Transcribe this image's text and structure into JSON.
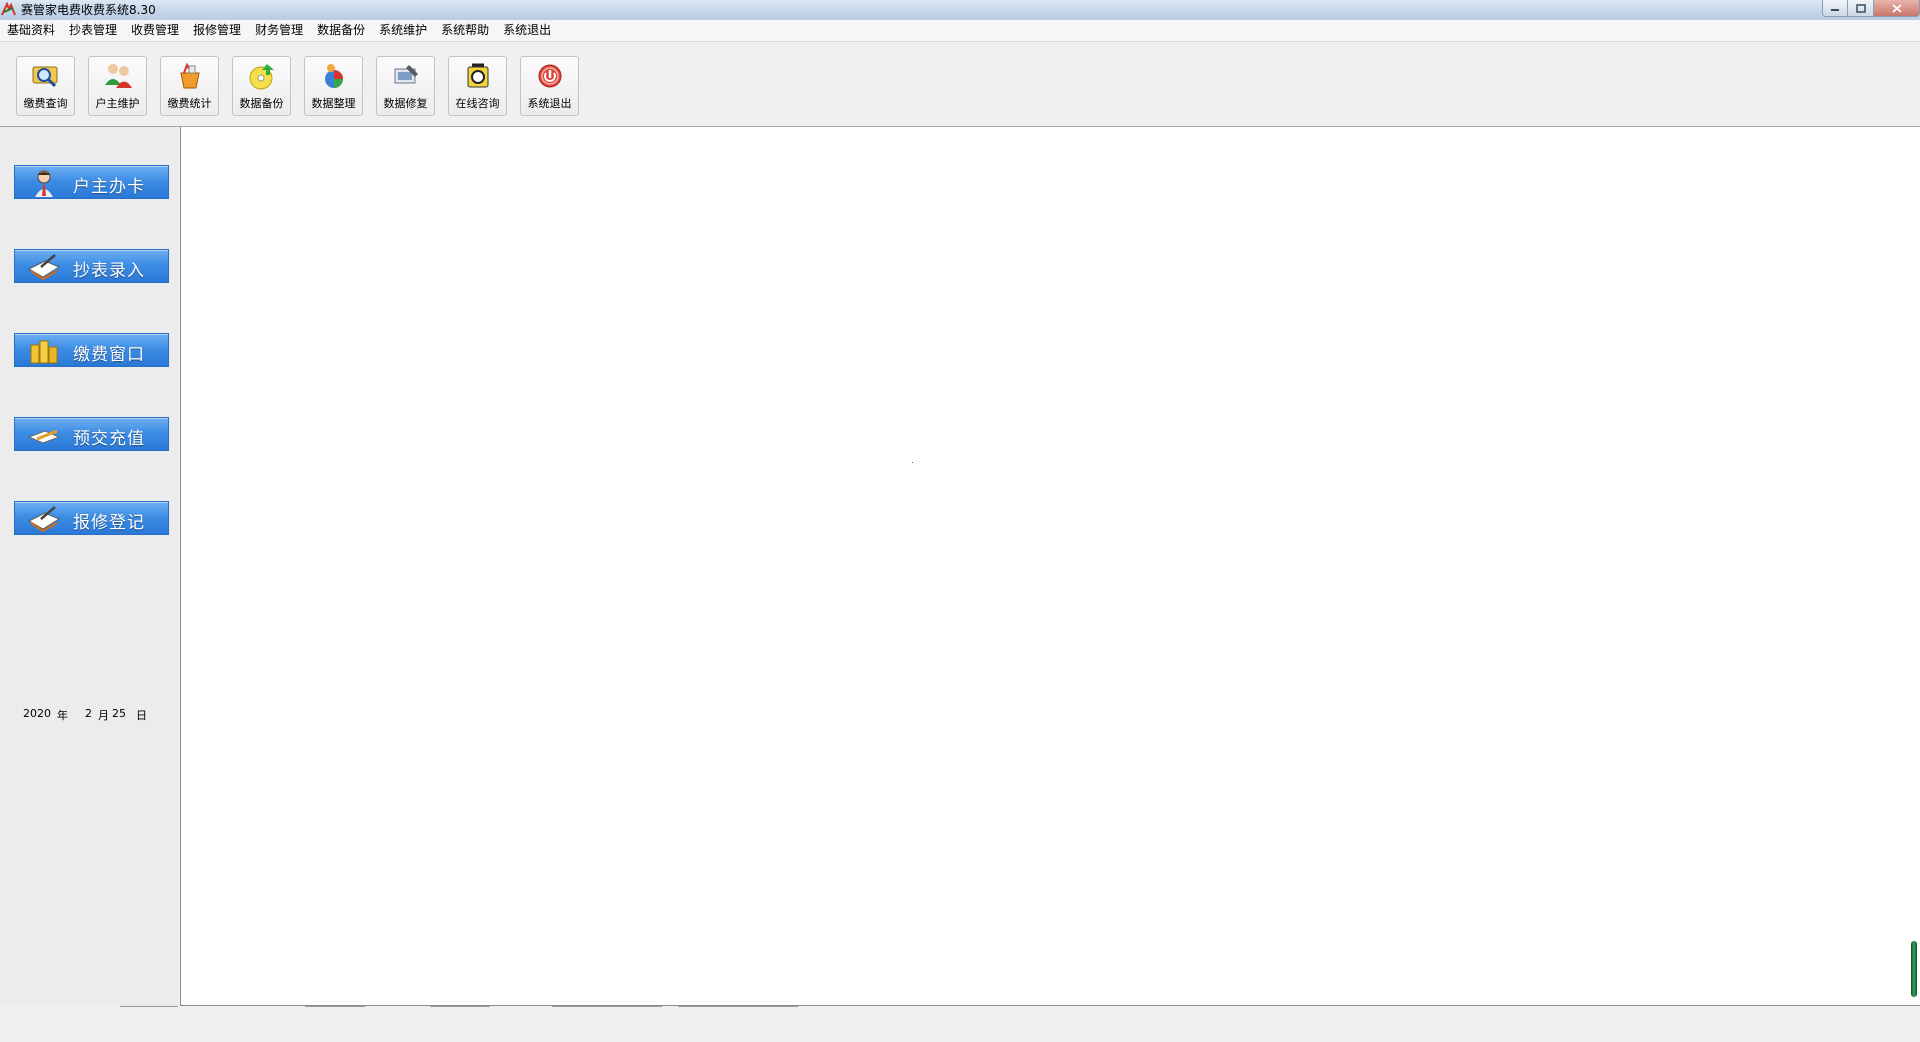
{
  "window": {
    "title": "赛管家电费收费系统8.30",
    "icon": "app-logo-icon"
  },
  "menu": [
    {
      "label": "基础资料"
    },
    {
      "label": "抄表管理"
    },
    {
      "label": "收费管理"
    },
    {
      "label": "报修管理"
    },
    {
      "label": "财务管理"
    },
    {
      "label": "数据备份"
    },
    {
      "label": "系统维护"
    },
    {
      "label": "系统帮助"
    },
    {
      "label": "系统退出"
    }
  ],
  "toolbar": [
    {
      "label": "缴费查询",
      "icon": "magnifier-icon"
    },
    {
      "label": "户主维护",
      "icon": "users-icon"
    },
    {
      "label": "缴费统计",
      "icon": "statistics-icon"
    },
    {
      "label": "数据备份",
      "icon": "backup-disc-icon"
    },
    {
      "label": "数据整理",
      "icon": "pie-chart-icon"
    },
    {
      "label": "数据修复",
      "icon": "repair-icon"
    },
    {
      "label": "在线咨询",
      "icon": "consult-icon"
    },
    {
      "label": "系统退出",
      "icon": "power-icon"
    }
  ],
  "sidebar": [
    {
      "label": "户主办卡",
      "icon": "person-icon"
    },
    {
      "label": "抄表录入",
      "icon": "notebook-pen-icon"
    },
    {
      "label": "缴费窗口",
      "icon": "coins-icon"
    },
    {
      "label": "预交充值",
      "icon": "card-pen-icon"
    },
    {
      "label": "报修登记",
      "icon": "notebook-pen-icon"
    }
  ],
  "date": {
    "year": "2020",
    "year_unit": "年",
    "month": "2",
    "month_unit": "月",
    "day": "25",
    "day_unit": "日"
  },
  "colors": {
    "sidebar_button": "#3e8de4",
    "titlebar": "#c4d6ea",
    "close_button": "#c9766a"
  }
}
